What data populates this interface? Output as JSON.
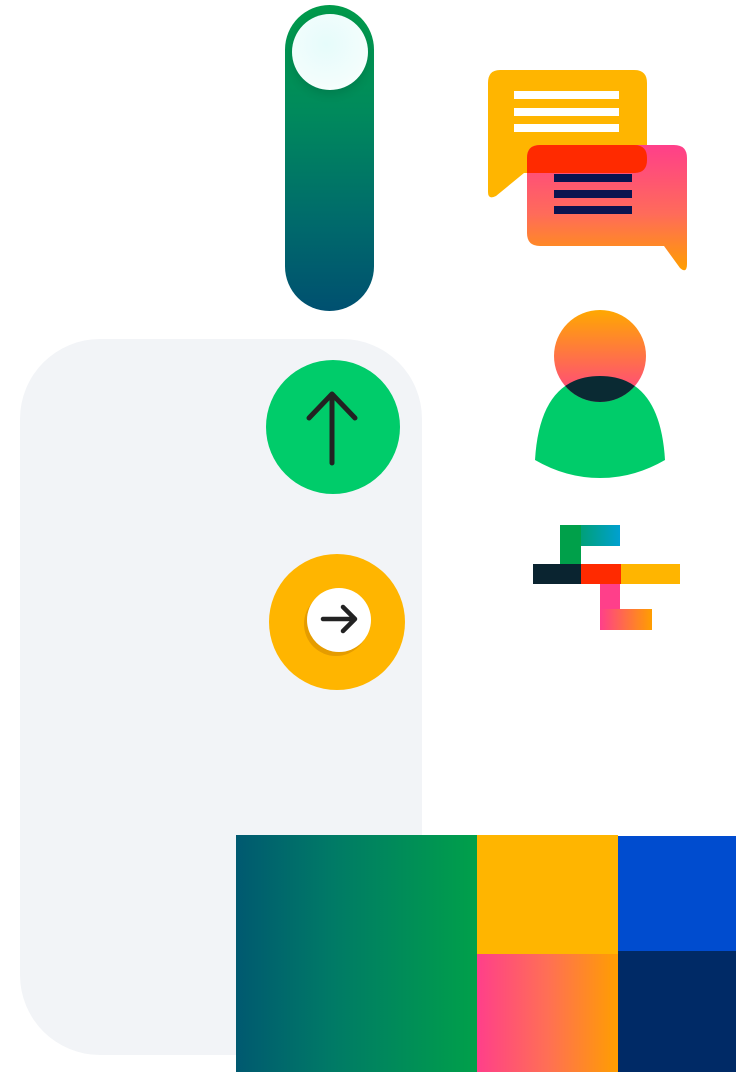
{
  "colors": {
    "panel": "#f2f4f7",
    "green_bright": "#00cc6a",
    "green_dark": "#00a04a",
    "teal_dark": "#005070",
    "yellow": "#ffb500",
    "pink": "#ff3f8a",
    "orange": "#ff9e00",
    "red": "#ff2a00",
    "blue": "#004ccf",
    "navy": "#002a66",
    "ink": "#222222"
  },
  "icons": {
    "toggle": "vertical-toggle-switch",
    "up": "arrow-up-icon",
    "right": "arrow-right-icon",
    "chat": "chat-bubbles-icon",
    "user": "user-icon",
    "blocks": "abstract-blocks-icon"
  }
}
